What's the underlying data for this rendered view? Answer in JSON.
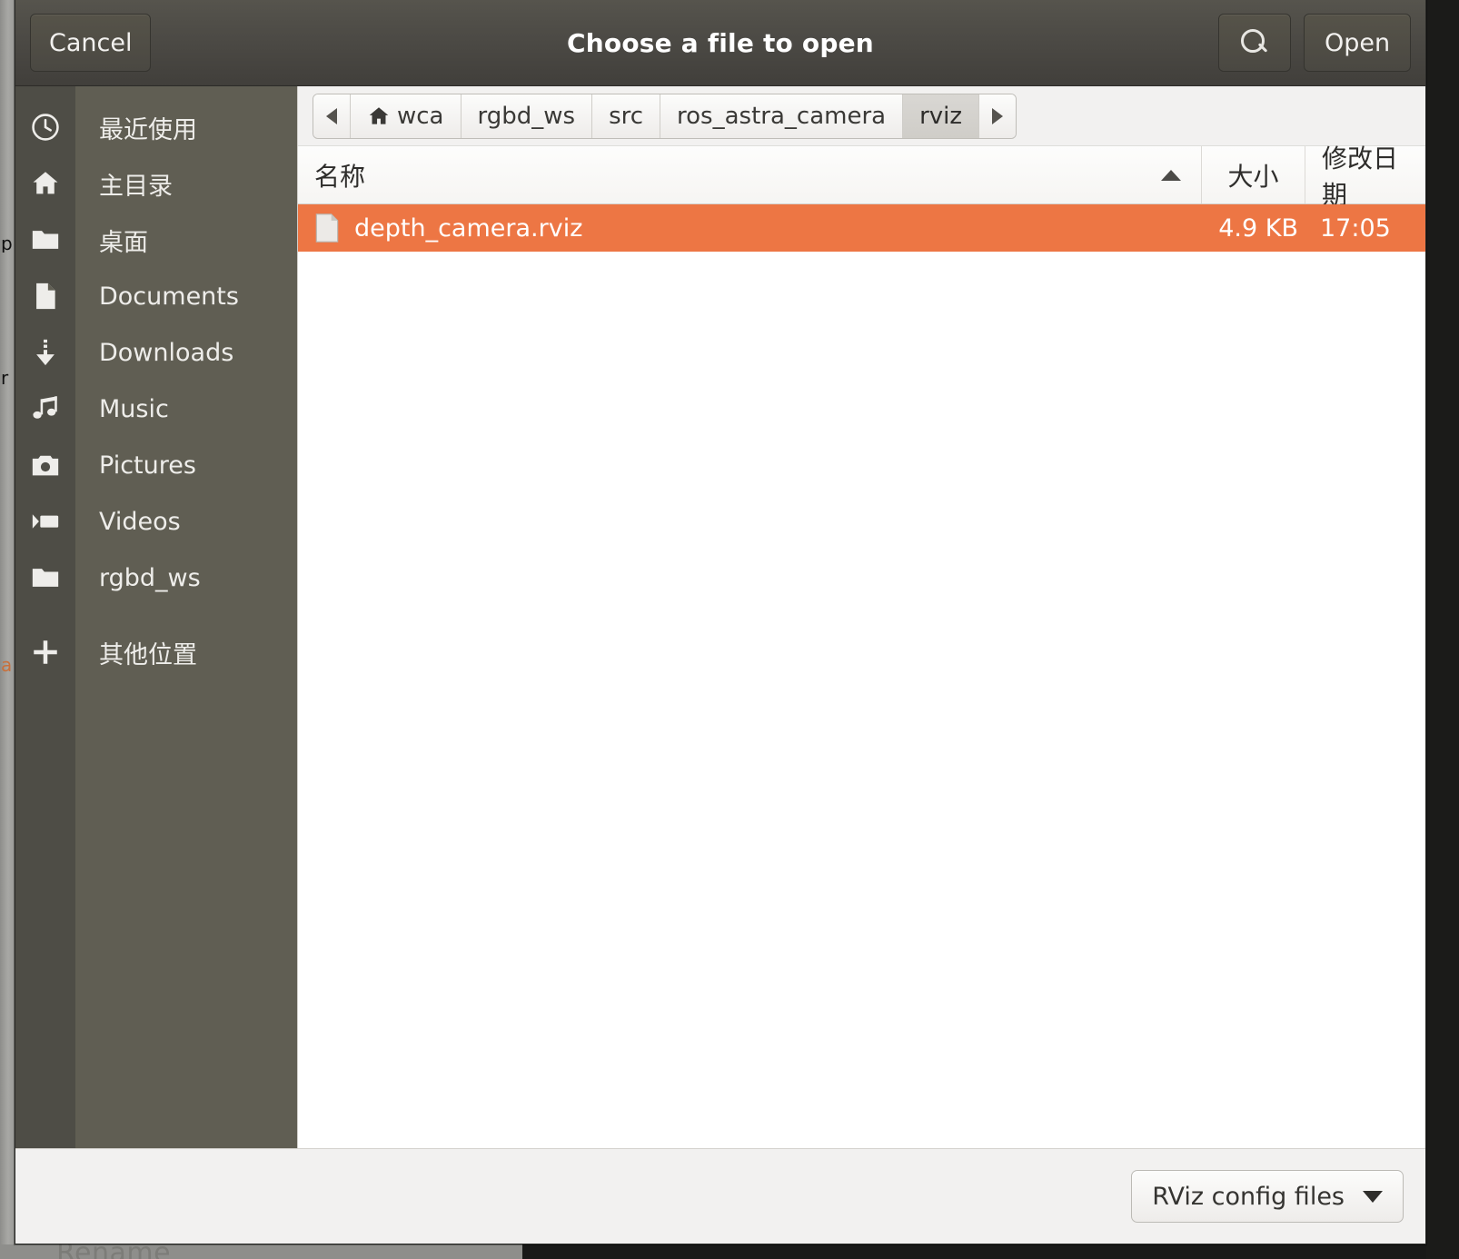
{
  "window": {
    "title": "Choose a file to open"
  },
  "header": {
    "cancel_label": "Cancel",
    "open_label": "Open",
    "search_icon": "search-icon"
  },
  "sidebar": {
    "items": [
      {
        "label": "最近使用",
        "icon": "clock-icon"
      },
      {
        "label": "主目录",
        "icon": "home-icon"
      },
      {
        "label": "桌面",
        "icon": "folder-icon"
      },
      {
        "label": "Documents",
        "icon": "document-icon"
      },
      {
        "label": "Downloads",
        "icon": "download-icon"
      },
      {
        "label": "Music",
        "icon": "music-note-icon"
      },
      {
        "label": "Pictures",
        "icon": "camera-icon"
      },
      {
        "label": "Videos",
        "icon": "video-icon"
      },
      {
        "label": "rgbd_ws",
        "icon": "folder-icon"
      },
      {
        "label": "其他位置",
        "icon": "plus-icon"
      }
    ]
  },
  "pathbar": {
    "prev_label": "◀",
    "next_label": "▶",
    "crumbs": [
      {
        "label": "wca",
        "icon": "home-icon",
        "active": false
      },
      {
        "label": "rgbd_ws",
        "active": false
      },
      {
        "label": "src",
        "active": false
      },
      {
        "label": "ros_astra_camera",
        "active": false
      },
      {
        "label": "rviz",
        "active": true
      }
    ]
  },
  "filelist": {
    "columns": {
      "name": "名称",
      "size": "大小",
      "modified": "修改日期"
    },
    "sort": {
      "column": "名称",
      "direction": "ascending"
    },
    "rows": [
      {
        "name": "depth_camera.rviz",
        "size": "4.9 KB",
        "modified": "17:05",
        "icon": "document-icon",
        "selected": true
      }
    ]
  },
  "actionbar": {
    "filter_label": "RViz config files"
  },
  "background": {
    "fragment_1": "p",
    "fragment_2": "r",
    "fragment_3": "a",
    "ghost_text": "Rename"
  },
  "colors": {
    "selection": "#ed7644",
    "titlebar_top": "#56544d",
    "titlebar_bottom": "#413f3b",
    "sidebar_icons": "#4e4d46",
    "sidebar_labels": "#605e53"
  }
}
